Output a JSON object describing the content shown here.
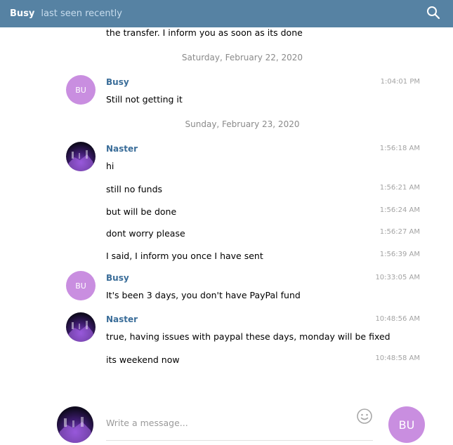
{
  "header": {
    "name": "Busy",
    "status": "last seen recently"
  },
  "icons": {
    "search": "search-icon",
    "emoji": "smile-icon"
  },
  "colors": {
    "header_bg": "#5682a3",
    "sender_name": "#3a6d99",
    "avatar_busy": "#c98ee0"
  },
  "messages": {
    "m0": {
      "text": "the transfer. I inform you as soon as its done"
    },
    "date1": "Saturday, February 22, 2020",
    "m1": {
      "sender": "Busy",
      "initials": "BU",
      "time": "1:04:01 PM",
      "text": "Still not getting it"
    },
    "date2": "Sunday, February 23, 2020",
    "m2": {
      "sender": "Naster",
      "time": "1:56:18 AM",
      "text": "hi"
    },
    "m3": {
      "time": "1:56:21 AM",
      "text": "still no funds"
    },
    "m4": {
      "time": "1:56:24 AM",
      "text": "but will be done"
    },
    "m5": {
      "time": "1:56:27 AM",
      "text": "dont worry please"
    },
    "m6": {
      "time": "1:56:39 AM",
      "text": "I said, I inform you once I have sent"
    },
    "m7": {
      "sender": "Busy",
      "initials": "BU",
      "time": "10:33:05 AM",
      "text": "It's been 3 days, you don't have PayPal fund"
    },
    "m8": {
      "sender": "Naster",
      "time": "10:48:56 AM",
      "text": "true, having issues with paypal these days, monday will be fixed"
    },
    "m9": {
      "time": "10:48:58 AM",
      "text": "its weekend now"
    }
  },
  "composer": {
    "placeholder": "Write a message...",
    "send_initials": "BU"
  }
}
